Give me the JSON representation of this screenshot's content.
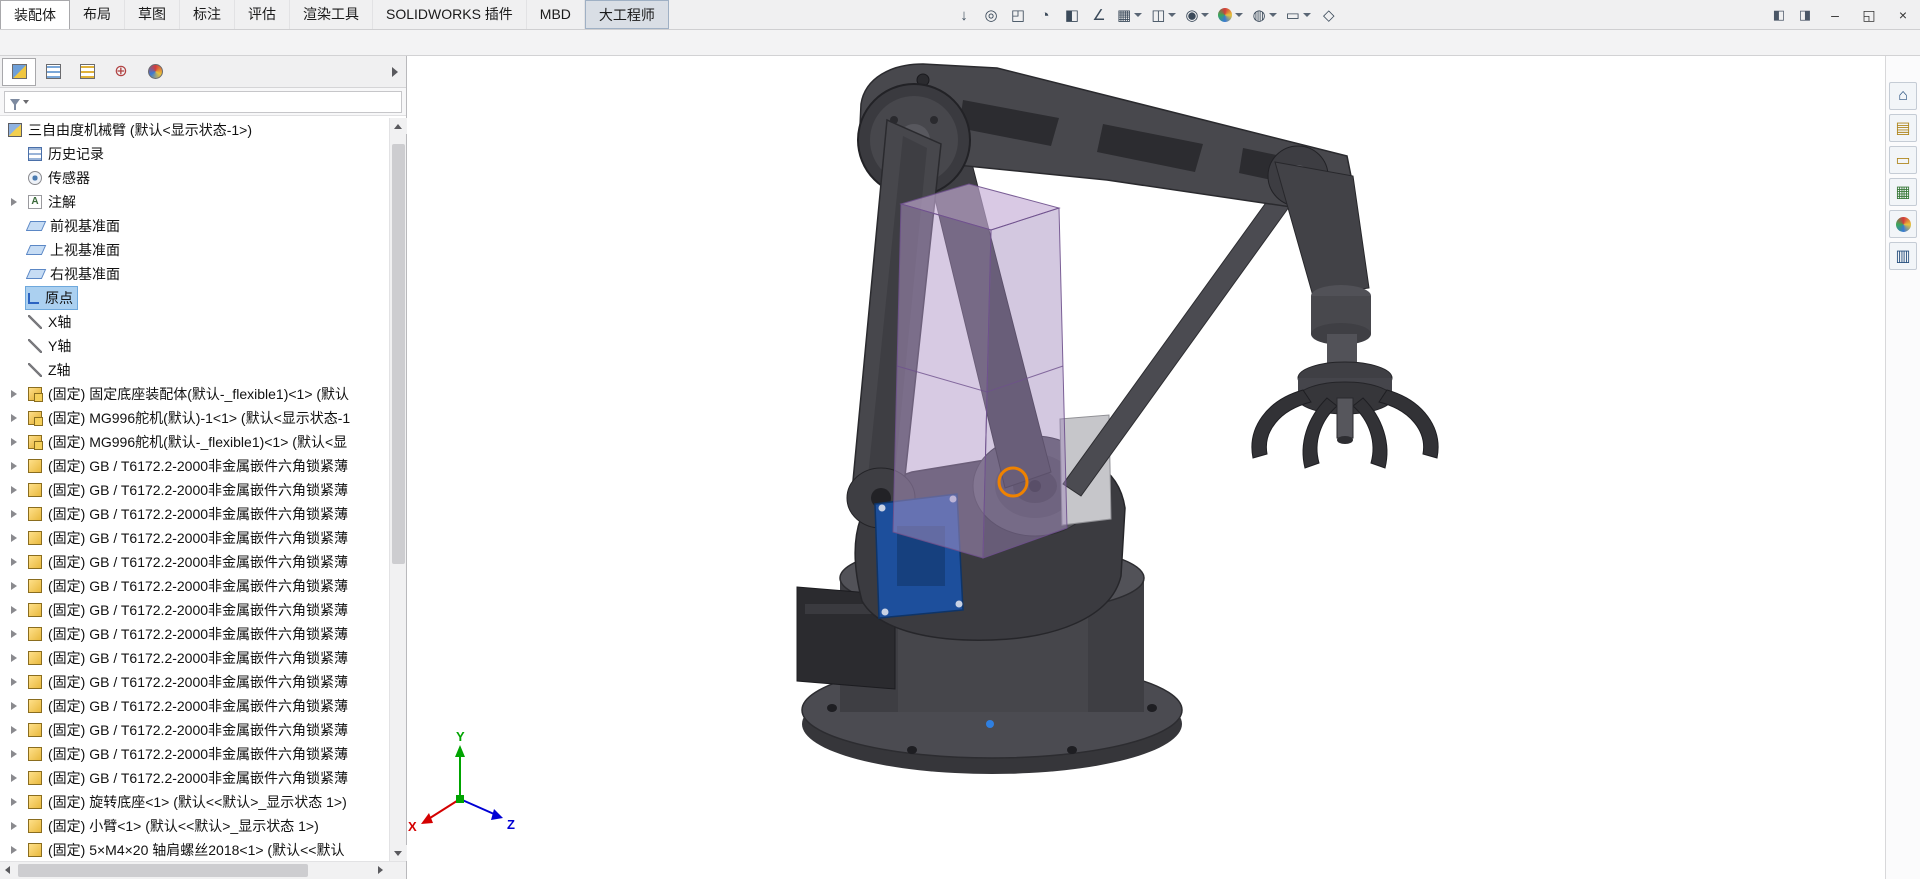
{
  "colors": {
    "selection_highlight": "#ef8200",
    "tree_selection_bg": "#abd0f0",
    "triad_x": "#d40000",
    "triad_y": "#00a400",
    "triad_z": "#0000d4",
    "origin_point": "#2f7fe0"
  },
  "titlebar": {
    "tabs": [
      {
        "label": "装配体",
        "cls": "active"
      },
      {
        "label": "布局"
      },
      {
        "label": "草图"
      },
      {
        "label": "标注"
      },
      {
        "label": "评估"
      },
      {
        "label": "渲染工具"
      },
      {
        "label": "SOLIDWORKS 插件"
      },
      {
        "label": "MBD"
      },
      {
        "label": "大工程师",
        "cls": "pressed"
      }
    ],
    "aux_buttons": [
      {
        "name": "show-pane-icon",
        "glyph": "◧"
      },
      {
        "name": "task-pane-icon",
        "glyph": "◨"
      }
    ],
    "window_buttons": [
      {
        "name": "minimize-button",
        "glyph": "–"
      },
      {
        "name": "restore-button",
        "glyph": "◱"
      },
      {
        "name": "close-button",
        "glyph": "×"
      }
    ]
  },
  "toolbar": {
    "icons": [
      {
        "name": "arrow-select-icon",
        "glyph": "↓",
        "caret": false
      },
      {
        "name": "zoom-fit-icon",
        "glyph": "◎",
        "caret": false
      },
      {
        "name": "zoom-area-icon",
        "glyph": "◰",
        "caret": false
      },
      {
        "name": "previous-view-icon",
        "glyph": "◔",
        "caret": false
      },
      {
        "name": "section-view-icon",
        "glyph": "◧",
        "caret": false
      },
      {
        "name": "measure-icon",
        "glyph": "∠",
        "caret": false
      },
      {
        "name": "view-orientation-icon",
        "glyph": "▦",
        "caret": true
      },
      {
        "name": "display-style-icon",
        "glyph": "◫",
        "caret": true
      },
      {
        "name": "hide-show-items-icon",
        "glyph": "◉",
        "caret": true
      },
      {
        "name": "edit-appearance-icon",
        "glyph": "●",
        "cls": "sphere",
        "caret": true
      },
      {
        "name": "apply-scene-icon",
        "glyph": "◍",
        "caret": true
      },
      {
        "name": "view-settings-icon",
        "glyph": "▭",
        "caret": true
      },
      {
        "name": "3d-views-icon",
        "glyph": "◇",
        "caret": false
      }
    ]
  },
  "panel": {
    "tabs": [
      {
        "name": "featuremanager-tab-icon",
        "cls": "pt-fm",
        "active": "active"
      },
      {
        "name": "propertymanager-tab-icon",
        "cls": "pt-pm"
      },
      {
        "name": "configurationmanager-tab-icon",
        "cls": "pt-cm"
      },
      {
        "name": "dimxpertmanager-tab-icon",
        "cls": "pt-dx",
        "glyph": "⊕"
      },
      {
        "name": "displaymanager-tab-icon",
        "cls": "pt-dm"
      }
    ],
    "tree": {
      "root": "三自由度机械臂 (默认<显示状态-1>)",
      "items": [
        {
          "label": "历史记录",
          "icon_cls": "ico-history",
          "icon_name": "history-folder-icon"
        },
        {
          "label": "传感器",
          "icon_cls": "ico-sensor",
          "icon_name": "sensors-icon"
        },
        {
          "label": "注解",
          "icon_cls": "ico-note",
          "icon_name": "annotations-icon",
          "exp_cls": "has-child"
        },
        {
          "label": "前视基准面",
          "icon_cls": "ico-plane",
          "icon_name": "front-plane-icon"
        },
        {
          "label": "上视基准面",
          "icon_cls": "ico-plane",
          "icon_name": "top-plane-icon"
        },
        {
          "label": "右视基准面",
          "icon_cls": "ico-plane",
          "icon_name": "right-plane-icon"
        },
        {
          "label": "原点",
          "icon_cls": "ico-origin",
          "icon_name": "origin-icon",
          "row_cls": "selected"
        },
        {
          "label": "X轴",
          "icon_cls": "ico-axis",
          "icon_name": "x-axis-icon"
        },
        {
          "label": "Y轴",
          "icon_cls": "ico-axis",
          "icon_name": "y-axis-icon"
        },
        {
          "label": "Z轴",
          "icon_cls": "ico-axis",
          "icon_name": "z-axis-icon"
        },
        {
          "label": "(固定) 固定底座装配体(默认-_flexible1)<1> (默认",
          "icon_cls": "ico-asm",
          "icon_name": "assembly-component-icon",
          "exp_cls": "has-child"
        },
        {
          "label": "(固定) MG996舵机(默认)-1<1> (默认<显示状态-1",
          "icon_cls": "ico-asm",
          "icon_name": "assembly-component-icon",
          "exp_cls": "has-child"
        },
        {
          "label": "(固定) MG996舵机(默认-_flexible1)<1> (默认<显",
          "icon_cls": "ico-asm",
          "icon_name": "assembly-component-icon",
          "exp_cls": "has-child"
        },
        {
          "label": "(固定) GB / T6172.2-2000非金属嵌件六角锁紧薄",
          "icon_cls": "ico-part",
          "icon_name": "part-component-icon",
          "exp_cls": "has-child"
        },
        {
          "label": "(固定) GB / T6172.2-2000非金属嵌件六角锁紧薄",
          "icon_cls": "ico-part",
          "icon_name": "part-component-icon",
          "exp_cls": "has-child"
        },
        {
          "label": "(固定) GB / T6172.2-2000非金属嵌件六角锁紧薄",
          "icon_cls": "ico-part",
          "icon_name": "part-component-icon",
          "exp_cls": "has-child"
        },
        {
          "label": "(固定) GB / T6172.2-2000非金属嵌件六角锁紧薄",
          "icon_cls": "ico-part",
          "icon_name": "part-component-icon",
          "exp_cls": "has-child"
        },
        {
          "label": "(固定) GB / T6172.2-2000非金属嵌件六角锁紧薄",
          "icon_cls": "ico-part",
          "icon_name": "part-component-icon",
          "exp_cls": "has-child"
        },
        {
          "label": "(固定) GB / T6172.2-2000非金属嵌件六角锁紧薄",
          "icon_cls": "ico-part",
          "icon_name": "part-component-icon",
          "exp_cls": "has-child"
        },
        {
          "label": "(固定) GB / T6172.2-2000非金属嵌件六角锁紧薄",
          "icon_cls": "ico-part",
          "icon_name": "part-component-icon",
          "exp_cls": "has-child"
        },
        {
          "label": "(固定) GB / T6172.2-2000非金属嵌件六角锁紧薄",
          "icon_cls": "ico-part",
          "icon_name": "part-component-icon",
          "exp_cls": "has-child"
        },
        {
          "label": "(固定) GB / T6172.2-2000非金属嵌件六角锁紧薄",
          "icon_cls": "ico-part",
          "icon_name": "part-component-icon",
          "exp_cls": "has-child"
        },
        {
          "label": "(固定) GB / T6172.2-2000非金属嵌件六角锁紧薄",
          "icon_cls": "ico-part",
          "icon_name": "part-component-icon",
          "exp_cls": "has-child"
        },
        {
          "label": "(固定) GB / T6172.2-2000非金属嵌件六角锁紧薄",
          "icon_cls": "ico-part",
          "icon_name": "part-component-icon",
          "exp_cls": "has-child"
        },
        {
          "label": "(固定) GB / T6172.2-2000非金属嵌件六角锁紧薄",
          "icon_cls": "ico-part",
          "icon_name": "part-component-icon",
          "exp_cls": "has-child"
        },
        {
          "label": "(固定) GB / T6172.2-2000非金属嵌件六角锁紧薄",
          "icon_cls": "ico-part",
          "icon_name": "part-component-icon",
          "exp_cls": "has-child"
        },
        {
          "label": "(固定) GB / T6172.2-2000非金属嵌件六角锁紧薄",
          "icon_cls": "ico-part",
          "icon_name": "part-component-icon",
          "exp_cls": "has-child"
        },
        {
          "label": "(固定) 旋转底座<1> (默认<<默认>_显示状态 1>)",
          "icon_cls": "ico-part",
          "icon_name": "part-component-icon",
          "exp_cls": "has-child"
        },
        {
          "label": "(固定) 小臂<1> (默认<<默认>_显示状态 1>)",
          "icon_cls": "ico-part",
          "icon_name": "part-component-icon",
          "exp_cls": "has-child"
        },
        {
          "label": "(固定) 5×M4×20 轴肩螺丝2018<1> (默认<<默认",
          "icon_cls": "ico-part",
          "icon_name": "part-component-icon",
          "exp_cls": "has-child"
        }
      ]
    }
  },
  "viewport": {
    "model_name": "三自由度机械臂",
    "triad": {
      "x": "X",
      "y": "Y",
      "z": "Z"
    }
  },
  "task_pane": {
    "icons": [
      {
        "name": "home-icon",
        "glyph": "⌂"
      },
      {
        "name": "design-library-icon",
        "glyph": "▤",
        "cls": "gold"
      },
      {
        "name": "file-explorer-icon",
        "glyph": "▭",
        "cls": "gold"
      },
      {
        "name": "view-palette-icon",
        "glyph": "▦",
        "cls": "green"
      },
      {
        "name": "appearances-scenes-icon",
        "glyph": "●",
        "cls": "sphere"
      },
      {
        "name": "custom-properties-icon",
        "glyph": "▥"
      }
    ]
  }
}
